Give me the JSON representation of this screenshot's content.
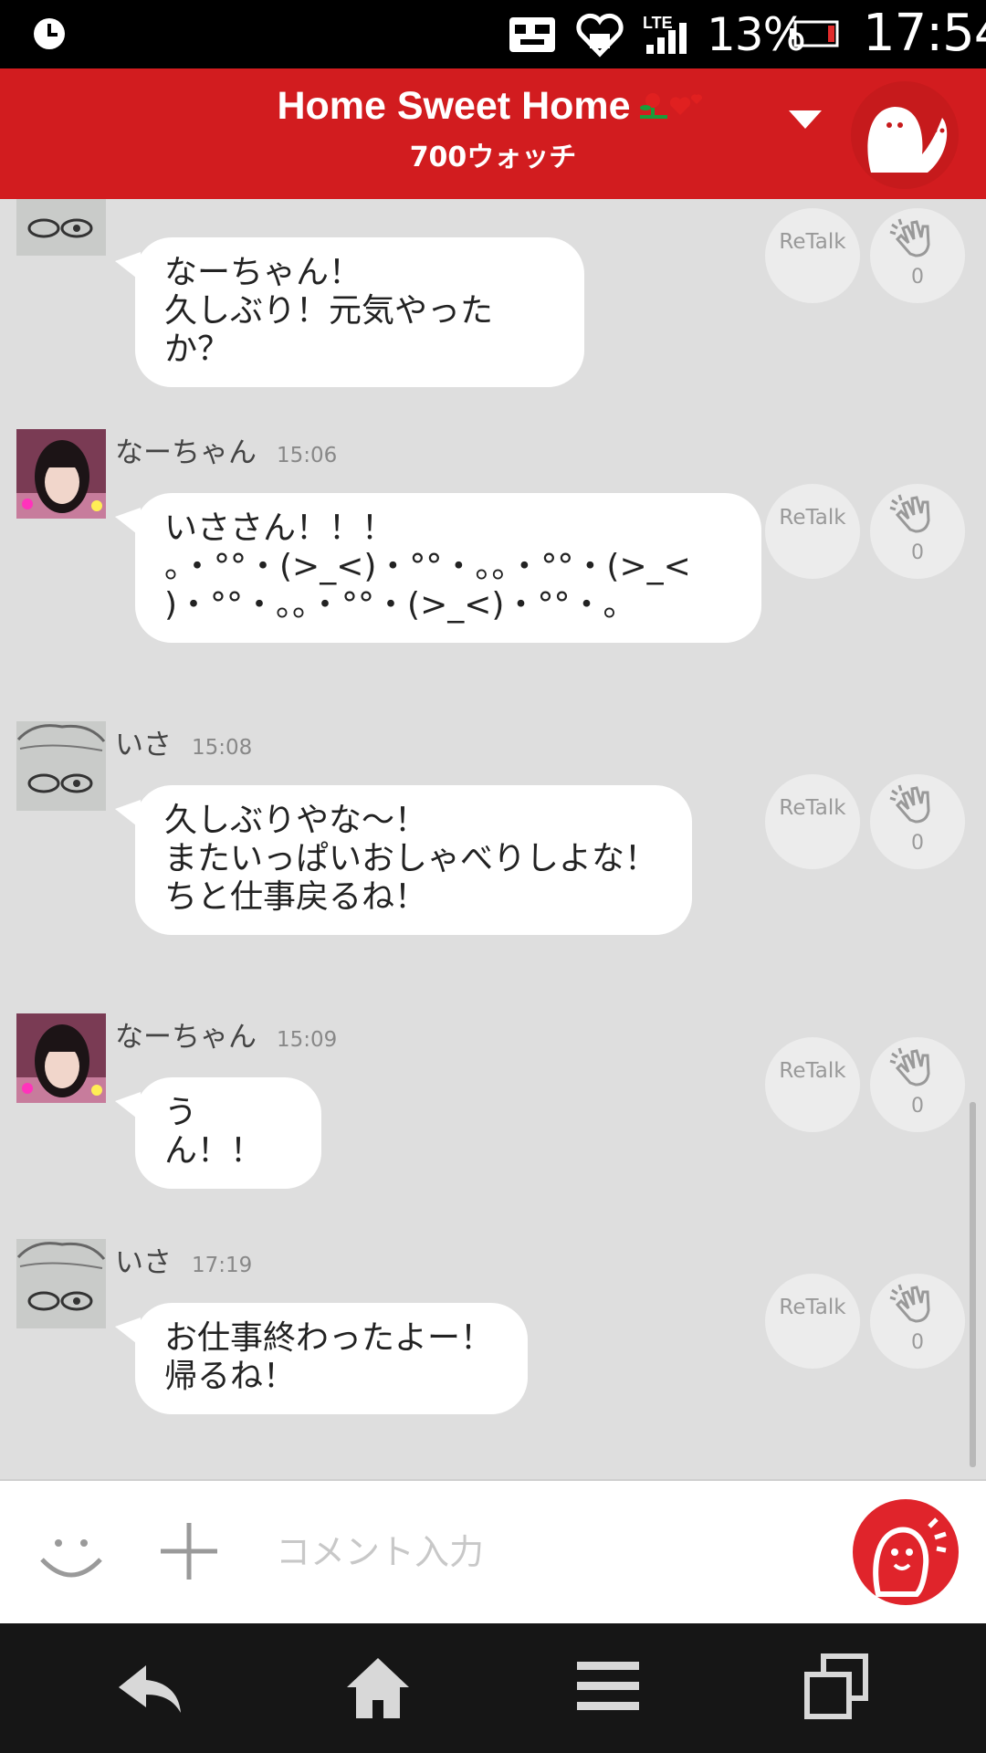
{
  "status_bar": {
    "battery_percent": "13%",
    "time": "17:54",
    "icons": [
      "alarm-icon",
      "notification-icon",
      "heart-icon",
      "lte-signal-icon",
      "battery-icon"
    ]
  },
  "header": {
    "title": "Home Sweet Home",
    "subtitle": "700ウォッチ",
    "accent_color": "#d21c1f"
  },
  "messages": [
    {
      "name": "",
      "time": "",
      "text": "なーちゃん！\n久しぶり！元気やったか？",
      "retalk_label": "ReTalk",
      "clap_count": "0"
    },
    {
      "name": "なーちゃん",
      "time": "15:06",
      "text": "いささん！！！\n。・°°・(>_<)・°°・。。・°°・(>_<\n)・°°・。。・°°・(>_<)・°°・。",
      "retalk_label": "ReTalk",
      "clap_count": "0"
    },
    {
      "name": "いさ",
      "time": "15:08",
      "text": "久しぶりやな～！\nまたいっぱいおしゃべりしよな！\nちと仕事戻るね！",
      "retalk_label": "ReTalk",
      "clap_count": "0"
    },
    {
      "name": "なーちゃん",
      "time": "15:09",
      "text": "うん！！",
      "retalk_label": "ReTalk",
      "clap_count": "0"
    },
    {
      "name": "いさ",
      "time": "17:19",
      "text": "お仕事終わったよー！\n帰るね！",
      "retalk_label": "ReTalk",
      "clap_count": "0"
    }
  ],
  "input": {
    "placeholder": "コメント入力"
  },
  "nav": [
    "back-icon",
    "home-icon",
    "menu-icon",
    "recent-apps-icon"
  ]
}
